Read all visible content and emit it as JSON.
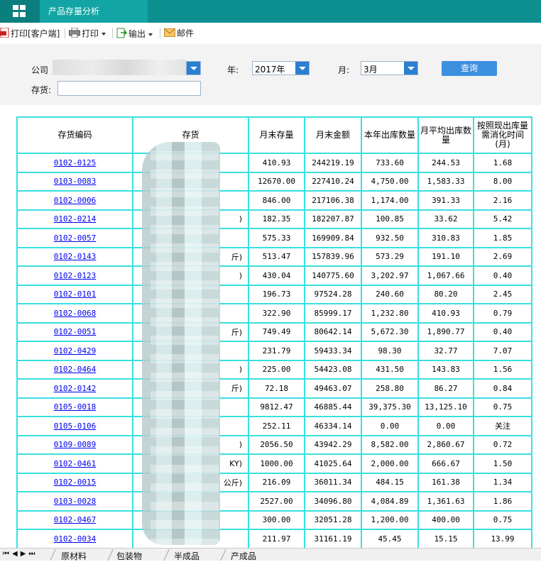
{
  "app": {
    "tab_title": "产品存量分析"
  },
  "toolbar": {
    "print_client_label": "打印[客户端]",
    "print_label": "打印",
    "export_label": "输出",
    "mail_label": "邮件"
  },
  "filters": {
    "company_label": "公司",
    "year_label": "年:",
    "year_value": "2017年",
    "month_label": "月:",
    "month_value": "3月",
    "query_label": "查询",
    "inventory_label": "存货:"
  },
  "table": {
    "headers": [
      "存货编码",
      "存货",
      "月末存量",
      "月末金额",
      "本年出库数量",
      "月平均出库数量",
      "按照现出库量需消化时间(月)"
    ],
    "rows": [
      {
        "code": "0102-0125",
        "inv": "",
        "qty": "410.93",
        "amt": "244219.19",
        "out": "733.60",
        "avg": "244.53",
        "months": "1.68"
      },
      {
        "code": "0103-0083",
        "inv": "",
        "qty": "12670.00",
        "amt": "227410.24",
        "out": "4,750.00",
        "avg": "1,583.33",
        "months": "8.00"
      },
      {
        "code": "0102-0006",
        "inv": "",
        "qty": "846.00",
        "amt": "217106.38",
        "out": "1,174.00",
        "avg": "391.33",
        "months": "2.16"
      },
      {
        "code": "0102-0214",
        "inv": ")",
        "qty": "182.35",
        "amt": "182207.87",
        "out": "100.85",
        "avg": "33.62",
        "months": "5.42"
      },
      {
        "code": "0102-0057",
        "inv": "",
        "qty": "575.33",
        "amt": "169909.84",
        "out": "932.50",
        "avg": "310.83",
        "months": "1.85"
      },
      {
        "code": "0102-0143",
        "inv": "斤)",
        "qty": "513.47",
        "amt": "157839.96",
        "out": "573.29",
        "avg": "191.10",
        "months": "2.69"
      },
      {
        "code": "0102-0123",
        "inv": ")",
        "qty": "430.04",
        "amt": "140775.60",
        "out": "3,202.97",
        "avg": "1,067.66",
        "months": "0.40"
      },
      {
        "code": "0102-0101",
        "inv": "",
        "qty": "196.73",
        "amt": "97524.28",
        "out": "240.60",
        "avg": "80.20",
        "months": "2.45"
      },
      {
        "code": "0102-0068",
        "inv": "",
        "qty": "322.90",
        "amt": "85999.17",
        "out": "1,232.80",
        "avg": "410.93",
        "months": "0.79"
      },
      {
        "code": "0102-0051",
        "inv": "斤)",
        "qty": "749.49",
        "amt": "80642.14",
        "out": "5,672.30",
        "avg": "1,890.77",
        "months": "0.40"
      },
      {
        "code": "0102-0429",
        "inv": "",
        "qty": "231.79",
        "amt": "59433.34",
        "out": "98.30",
        "avg": "32.77",
        "months": "7.07"
      },
      {
        "code": "0102-0464",
        "inv": ")",
        "qty": "225.00",
        "amt": "54423.08",
        "out": "431.50",
        "avg": "143.83",
        "months": "1.56"
      },
      {
        "code": "0102-0142",
        "inv": "斤)",
        "qty": "72.18",
        "amt": "49463.07",
        "out": "258.80",
        "avg": "86.27",
        "months": "0.84"
      },
      {
        "code": "0105-0018",
        "inv": "",
        "qty": "9812.47",
        "amt": "46885.44",
        "out": "39,375.30",
        "avg": "13,125.10",
        "months": "0.75"
      },
      {
        "code": "0105-0106",
        "inv": "",
        "qty": "252.11",
        "amt": "46334.14",
        "out": "0.00",
        "avg": "0.00",
        "months": "关注"
      },
      {
        "code": "0109-0089",
        "inv": ")",
        "qty": "2056.50",
        "amt": "43942.29",
        "out": "8,582.00",
        "avg": "2,860.67",
        "months": "0.72"
      },
      {
        "code": "0102-0461",
        "inv": "KY)",
        "qty": "1000.00",
        "amt": "41025.64",
        "out": "2,000.00",
        "avg": "666.67",
        "months": "1.50"
      },
      {
        "code": "0102-0015",
        "inv": "公斤)",
        "qty": "216.09",
        "amt": "36011.34",
        "out": "484.15",
        "avg": "161.38",
        "months": "1.34"
      },
      {
        "code": "0103-0028",
        "inv": "",
        "qty": "2527.00",
        "amt": "34096.80",
        "out": "4,084.89",
        "avg": "1,361.63",
        "months": "1.86"
      },
      {
        "code": "0102-0467",
        "inv": "",
        "qty": "300.00",
        "amt": "32051.28",
        "out": "1,200.00",
        "avg": "400.00",
        "months": "0.75"
      },
      {
        "code": "0102-0034",
        "inv": "",
        "qty": "211.97",
        "amt": "31161.19",
        "out": "45.45",
        "avg": "15.15",
        "months": "13.99"
      }
    ]
  },
  "sheets": [
    "原材料",
    "包装物",
    "半成品",
    "产成品"
  ],
  "colors": {
    "titlebar": "#0d8f8f",
    "grid_border": "#38e0e0",
    "link": "#0000ee",
    "query_button": "#3d8fe0"
  }
}
